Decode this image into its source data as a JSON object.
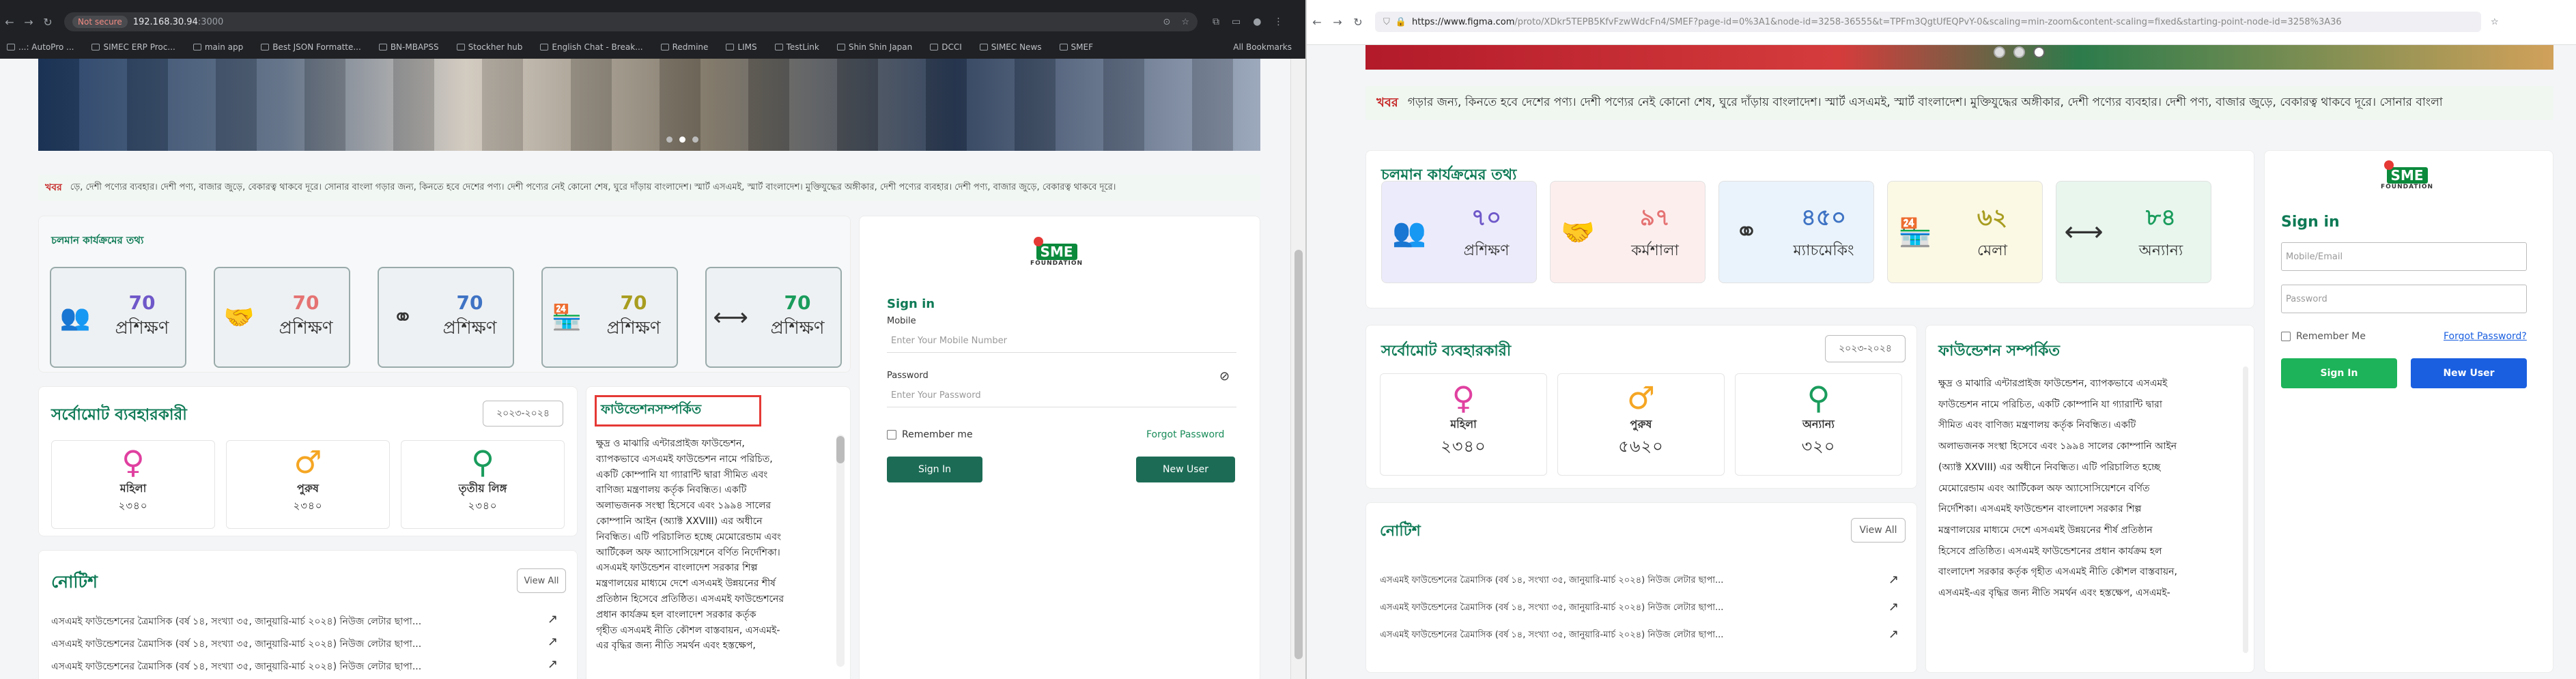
{
  "left": {
    "browser": {
      "security": "Not secure",
      "url_host": "192.168.30.94",
      "url_port": ":3000",
      "bookmarks": [
        "...: AutoPro ...",
        "SIMEC ERP Proc...",
        "main app",
        "Best JSON Formatte...",
        "BN-MBAPSS",
        "Stockher hub",
        "English Chat - Break...",
        "Redmine",
        "LIMS",
        "TestLink",
        "Shin Shin Japan",
        "DCCI",
        "SIMEC News",
        "SMEF"
      ],
      "all_bookmarks": "All Bookmarks"
    },
    "news": {
      "label": "খবর",
      "text": "ড়ে, দেশী পণ্যের ব্যবহার। দেশী পণ্য, বাজার জুড়ে, বেকারত্ব থাকবে দূরে। সোনার বাংলা গড়ার জন্য, কিনতে হবে দেশের পণ্য। দেশী পণ্যের নেই কোনো শেষ, ঘুরে দাঁড়ায় বাংলাদেশ। স্মার্ট এসএমই, স্মার্ট বাংলাদেশ। মুক্তিযুদ্ধের অঙ্গীকার, দেশী পণ্যের ব্যবহার। দেশী পণ্য, বাজার জুড়ে, বেকারত্ব থাকবে দূরে।"
    },
    "ongoing_title": "চলমান কার্যক্রমের তথ্য",
    "stats": [
      {
        "icon": "👥",
        "num": "70",
        "label": "প্রশিক্ষণ",
        "color": "#6f58c9"
      },
      {
        "icon": "🤝",
        "num": "70",
        "label": "প্রশিক্ষণ",
        "color": "#e57373"
      },
      {
        "icon": "⚭",
        "num": "70",
        "label": "প্রশিক্ষণ",
        "color": "#3f73c4"
      },
      {
        "icon": "🏪",
        "num": "70",
        "label": "প্রশিক্ষণ",
        "color": "#a89d20"
      },
      {
        "icon": "⟷",
        "num": "70",
        "label": "প্রশিক্ষণ",
        "color": "#1a9c5c"
      }
    ],
    "users": {
      "title": "সর্বোমোট ব্যবহারকারী",
      "year": "২০২৩-২০২৪",
      "items": [
        {
          "sym": "♀",
          "label": "মহিলা",
          "value": "২৩৪০",
          "color": "#e040a0"
        },
        {
          "sym": "♂",
          "label": "পুরুষ",
          "value": "২৩৪০",
          "color": "#f5a623"
        },
        {
          "sym": "⚲",
          "label": "তৃতীয় লিঙ্গ",
          "value": "২৩৪০",
          "color": "#1a9c5c"
        }
      ]
    },
    "about": {
      "title": "ফাউন্ডেশনসম্পর্কিত",
      "lines": [
        "ক্ষুদ্র ও মাঝারি এন্টারপ্রাইজ ফাউন্ডেশন,",
        "ব্যাপকভাবে এসএমই ফাউন্ডেশন নামে পরিচিত,",
        "একটি কোম্পানি যা গ্যারান্টি দ্বারা সীমিত এবং",
        "বাণিজ্য মন্ত্রণালয় কর্তৃক নিবন্ধিত। একটি",
        "অলাভজনক সংস্থা হিসেবে এবং ১৯৯৪ সালের",
        "কোম্পানি আইন (অ্যাক্ট XXVIII) এর অধীনে",
        "নিবন্ধিত। এটি পরিচালিত হচ্ছে মেমোরেন্ডাম এবং",
        "আর্টিকেল অফ অ্যাসোসিয়েশনে বর্ণিত নির্দেশিকা।",
        "এসএমই ফাউন্ডেশন বাংলাদেশ সরকার শিল্প",
        "মন্ত্রণালয়ের মাধ্যমে দেশে এসএমই উন্নয়নের শীর্ষ",
        "প্রতিষ্ঠান হিসেবে প্রতিষ্ঠিত। এসএমই ফাউন্ডেশনের",
        "প্রধান কার্যক্রম হল বাংলাদেশ সরকার কর্তৃক",
        "গৃহীত এসএমই নীতি কৌশল বাস্তবায়ন, এসএমই-",
        "এর বৃদ্ধির জন্য নীতি সমর্থন এবং হস্তক্ষেপ,"
      ]
    },
    "notice": {
      "title": "নোটিশ",
      "view_all": "View All",
      "items": [
        "এসএমই ফাউন্ডেশনের ত্রৈমাসিক (বর্ষ ১৪, সংখ্যা ৩৫, জানুয়ারি-মার্চ ২০২৪) নিউজ লেটার ছাপা...",
        "এসএমই ফাউন্ডেশনের ত্রৈমাসিক (বর্ষ ১৪, সংখ্যা ৩৫, জানুয়ারি-মার্চ ২০২৪) নিউজ লেটার ছাপা...",
        "এসএমই ফাউন্ডেশনের ত্রৈমাসিক (বর্ষ ১৪, সংখ্যা ৩৫, জানুয়ারি-মার্চ ২০২৪) নিউজ লেটার ছাপা..."
      ]
    },
    "signin": {
      "logo": "SME",
      "logo_sub": "FOUNDATION",
      "title": "Sign in",
      "mobile_label": "Mobile",
      "mobile_placeholder": "Enter Your Mobile Number",
      "password_label": "Password",
      "password_placeholder": "Enter Your Password",
      "remember": "Remember me",
      "forgot": "Forgot Password",
      "signin_btn": "Sign In",
      "newuser_btn": "New User"
    }
  },
  "right": {
    "browser": {
      "url_host": "https://www.figma.com",
      "url_path": "/proto/XDkr5TEPB5KfvFzwWdcFn4/SMEF?page-id=0%3A1&node-id=3258-36555&t=TPFm3QgtUfEQPvY-0&scaling=min-zoom&content-scaling=fixed&starting-point-node-id=3258%3A36"
    },
    "news": {
      "label": "খবর",
      "text": "গড়ার জন্য, কিনতে হবে দেশের পণ্য। দেশী পণ্যের নেই কোনো শেষ, ঘুরে দাঁড়ায় বাংলাদেশ। স্মার্ট এসএমই, স্মার্ট বাংলাদেশ। মুক্তিযুদ্ধের অঙ্গীকার, দেশী পণ্যের ব্যবহার। দেশী পণ্য, বাজার জুড়ে, বেকারত্ব থাকবে দূরে। সোনার বাংলা"
    },
    "ongoing_title": "চলমান কার্যক্রমের তথ্য",
    "stats": [
      {
        "icon": "👥",
        "num": "৭০",
        "label": "প্রশিক্ষণ",
        "bg": "#ecebfb",
        "color": "#6f58c9"
      },
      {
        "icon": "🤝",
        "num": "৯৭",
        "label": "কর্মশালা",
        "bg": "#fdeeee",
        "color": "#e57373"
      },
      {
        "icon": "⚭",
        "num": "৪৫০",
        "label": "ম্যাচমেকিং",
        "bg": "#eaf3fb",
        "color": "#3f73c4"
      },
      {
        "icon": "🏪",
        "num": "৬২",
        "label": "মেলা",
        "bg": "#fbf8e4",
        "color": "#a89d20"
      },
      {
        "icon": "⟷",
        "num": "৮৪",
        "label": "অন্যান্য",
        "bg": "#e8f6ee",
        "color": "#1a9c5c"
      }
    ],
    "users": {
      "title": "সর্বোমোট ব্যবহারকারী",
      "year": "২০২৩-২০২৪",
      "items": [
        {
          "sym": "♀",
          "label": "মহিলা",
          "value": "২৩৪০",
          "color": "#e040a0"
        },
        {
          "sym": "♂",
          "label": "পুরুষ",
          "value": "৫৬২০",
          "color": "#f5a623"
        },
        {
          "sym": "⚲",
          "label": "অন্যান্য",
          "value": "৩২০",
          "color": "#1a9c5c"
        }
      ]
    },
    "about": {
      "title": "ফাউন্ডেশন সম্পর্কিত",
      "lines": [
        "ক্ষুদ্র ও মাঝারি এন্টারপ্রাইজ ফাউন্ডেশন, ব্যাপকভাবে এসএমই",
        "ফাউন্ডেশন নামে পরিচিত, একটি কোম্পানি যা গ্যারান্টি দ্বারা",
        "সীমিত এবং বাণিজ্য মন্ত্রণালয় কর্তৃক নিবন্ধিত। একটি",
        "অলাভজনক সংস্থা হিসেবে এবং ১৯৯৪ সালের কোম্পানি আইন",
        "(অ্যাক্ট XXVIII) এর অধীনে নিবন্ধিত। এটি পরিচালিত হচ্ছে",
        "মেমোরেন্ডাম এবং আর্টিকেল অফ অ্যাসোসিয়েশনে বর্ণিত",
        "নির্দেশিকা। এসএমই ফাউন্ডেশন বাংলাদেশ সরকার শিল্প",
        "মন্ত্রণালয়ের মাধ্যমে দেশে এসএমই উন্নয়নের শীর্ষ প্রতিষ্ঠান",
        "হিসেবে প্রতিষ্ঠিত। এসএমই ফাউন্ডেশনের প্রধান কার্যক্রম হল",
        "বাংলাদেশ সরকার কর্তৃক গৃহীত এসএমই নীতি কৌশল বাস্তবায়ন,",
        "এসএমই-এর বৃদ্ধির জন্য নীতি সমর্থন এবং হস্তক্ষেপ, এসএমই-"
      ]
    },
    "notice": {
      "title": "নোটিশ",
      "view_all": "View All",
      "items": [
        "এসএমই ফাউন্ডেশনের ত্রৈমাসিক (বর্ষ ১৪, সংখ্যা ৩৫, জানুয়ারি-মার্চ ২০২৪) নিউজ লেটার ছাপা...",
        "এসএমই ফাউন্ডেশনের ত্রৈমাসিক (বর্ষ ১৪, সংখ্যা ৩৫, জানুয়ারি-মার্চ ২০২৪) নিউজ লেটার ছাপা...",
        "এসএমই ফাউন্ডেশনের ত্রৈমাসিক (বর্ষ ১৪, সংখ্যা ৩৫, জানুয়ারি-মার্চ ২০২৪) নিউজ লেটার ছাপা..."
      ]
    },
    "signin": {
      "logo": "SME",
      "logo_sub": "FOUNDATION",
      "title": "Sign in",
      "mobile_placeholder": "Mobile/Email",
      "password_placeholder": "Password",
      "remember": "Remember Me",
      "forgot": "Forgot Password?",
      "signin_btn": "Sign In",
      "newuser_btn": "New User"
    }
  },
  "colors": {
    "green": "#0e7a55",
    "btn_green_left": "#1c6b55",
    "btn_green_right": "#1db35a",
    "btn_blue_right": "#1a5fe0",
    "highlight_red": "#e53935"
  }
}
